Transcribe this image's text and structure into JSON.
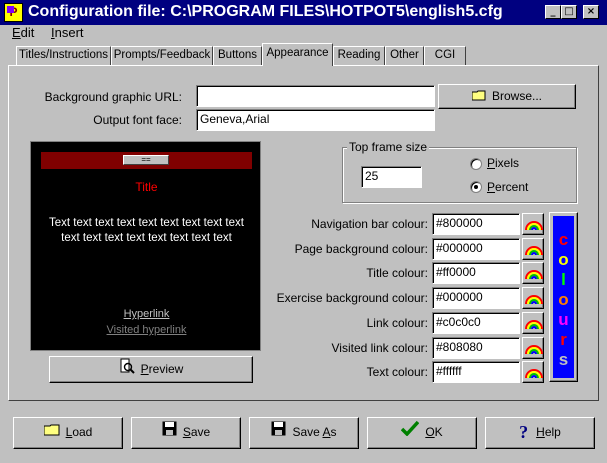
{
  "window": {
    "title": "Configuration file: C:\\PROGRAM FILES\\HOTPOT5\\english5.cfg",
    "min_glyph": "_",
    "max_glyph": "□",
    "close_glyph": "×"
  },
  "menu": {
    "edit": {
      "mnemonic": "E",
      "rest": "dit"
    },
    "insert": {
      "mnemonic": "I",
      "rest": "nsert"
    }
  },
  "tabs": [
    {
      "label": "Titles/Instructions"
    },
    {
      "label": "Prompts/Feedback"
    },
    {
      "label": "Buttons"
    },
    {
      "label": "Appearance"
    },
    {
      "label": "Reading"
    },
    {
      "label": "Other"
    },
    {
      "label": "CGI"
    }
  ],
  "active_tab": "Appearance",
  "appearance": {
    "bg_graphic_label": "Background graphic URL:",
    "bg_graphic_value": "",
    "browse_label": "Browse...",
    "font_face_label": "Output font face:",
    "font_face_value": "Geneva,Arial",
    "frame_size": {
      "legend": "Top frame size",
      "value": "25",
      "pixels_label": "Pixels",
      "pixels_mnemonic": "P",
      "pixels_rest": "ixels",
      "percent_label": "Percent",
      "percent_mnemonic": "P",
      "percent_rest": "ercent",
      "selected": "Percent"
    },
    "colours": [
      {
        "label": "Navigation bar colour:",
        "value": "#800000"
      },
      {
        "label": "Page background colour:",
        "value": "#000000"
      },
      {
        "label": "Title colour:",
        "value": "#ff0000"
      },
      {
        "label": "Exercise background colour:",
        "value": "#000000"
      },
      {
        "label": "Link colour:",
        "value": "#c0c0c0"
      },
      {
        "label": "Visited link colour:",
        "value": "#808080"
      },
      {
        "label": "Text colour:",
        "value": "#ffffff"
      }
    ],
    "colours_button_letters": [
      "c",
      "o",
      "l",
      "o",
      "u",
      "r",
      "s"
    ],
    "colours_button_letter_colors": [
      "#ff0000",
      "#ffff00",
      "#00ff00",
      "#ff8000",
      "#ff00ff",
      "#ff0000",
      "#c0c0c0"
    ],
    "preview": {
      "nav_button": "==",
      "title": "Title",
      "body": "Text text text text text text text text text text text text text text text text text",
      "hyperlink": "Hyperlink",
      "visited_hyperlink": "Visited hyperlink",
      "preview_button": {
        "mnemonic": "P",
        "rest": "review"
      }
    }
  },
  "bottom_buttons": [
    {
      "mnemonic": "L",
      "rest": "oad",
      "icon": "folder-icon"
    },
    {
      "mnemonic": "S",
      "rest": "ave",
      "icon": "floppy-icon"
    },
    {
      "pre": "Save ",
      "mnemonic": "A",
      "rest": "s",
      "icon": "save-as-icon"
    },
    {
      "mnemonic": "O",
      "rest": "K",
      "icon": "checkmark-icon"
    },
    {
      "mnemonic": "H",
      "rest": "elp",
      "icon": "help-icon"
    }
  ]
}
